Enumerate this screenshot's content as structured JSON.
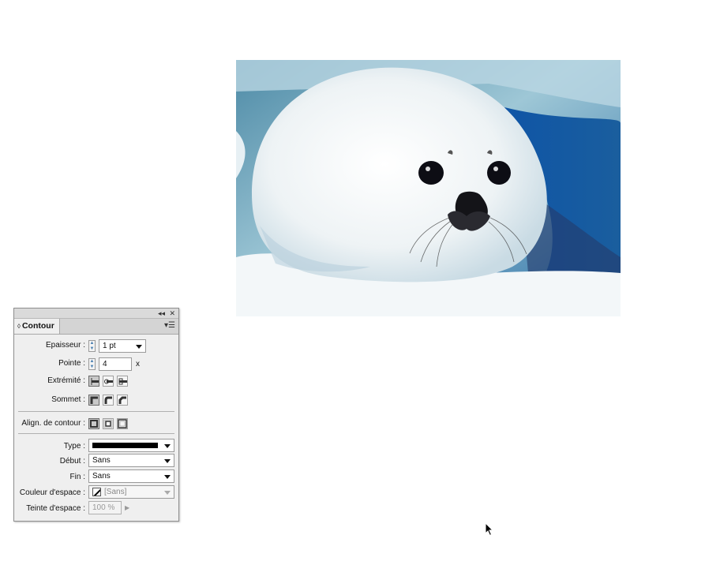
{
  "photo": {
    "subject": "harp-seal-pup-on-snow"
  },
  "panel": {
    "window_controls": {
      "collapse": "◂◂",
      "close": "✕"
    },
    "tab_title": "Contour",
    "weight": {
      "label": "Epaisseur :",
      "value": "1 pt"
    },
    "miter": {
      "label": "Pointe :",
      "value": "4",
      "suffix": "x"
    },
    "cap": {
      "label": "Extrémité :",
      "options": [
        "butt-cap-icon",
        "round-cap-icon",
        "projecting-cap-icon"
      ],
      "selected": 0
    },
    "join": {
      "label": "Sommet :",
      "options": [
        "miter-join-icon",
        "round-join-icon",
        "bevel-join-icon"
      ],
      "selected": 0
    },
    "align": {
      "label": "Align. de contour :",
      "options": [
        "align-center-icon",
        "align-inside-icon",
        "align-outside-icon"
      ],
      "selected": 0
    },
    "type": {
      "label": "Type :",
      "value": "solid"
    },
    "start": {
      "label": "Début :",
      "value": "Sans"
    },
    "end": {
      "label": "Fin :",
      "value": "Sans"
    },
    "gap_color": {
      "label": "Couleur d'espace :",
      "value": "[Sans]"
    },
    "gap_tint": {
      "label": "Teinte d'espace :",
      "value": "100 %"
    }
  }
}
